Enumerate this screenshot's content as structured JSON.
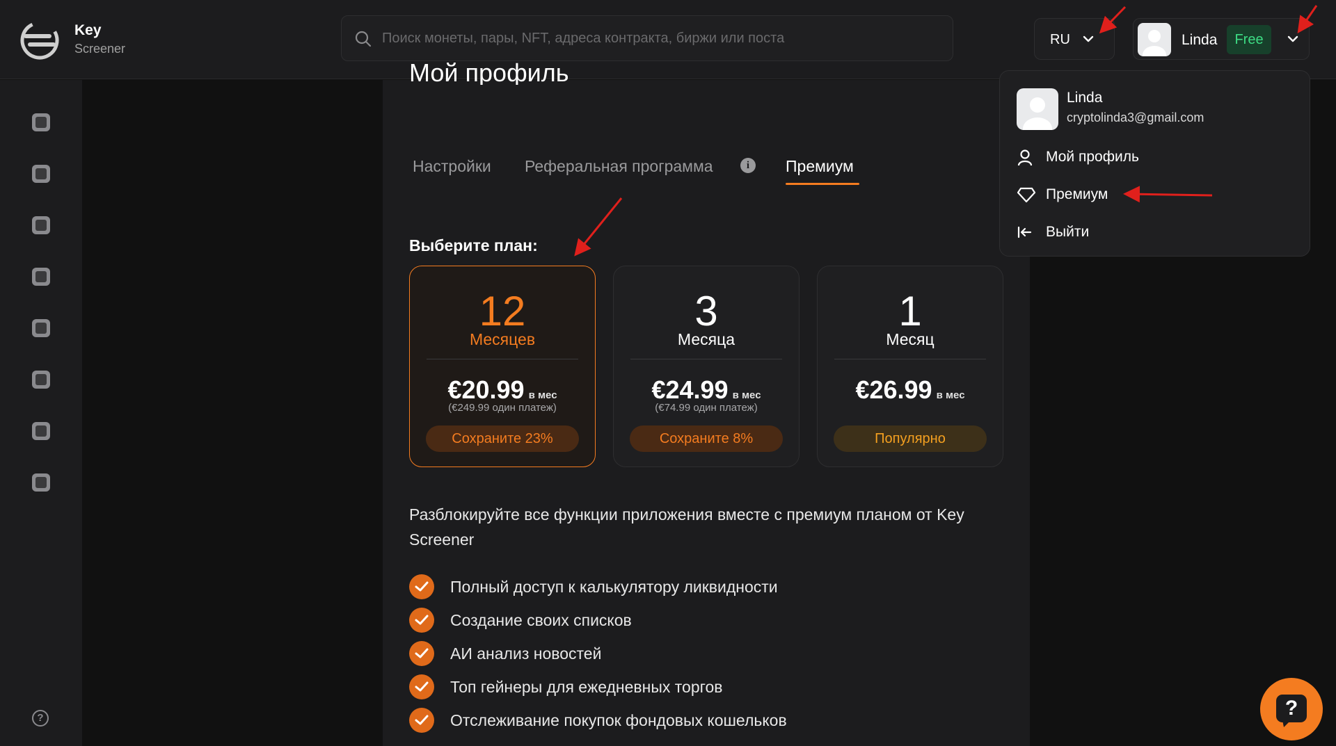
{
  "brand": {
    "name": "Key",
    "sub": "Screener"
  },
  "search": {
    "placeholder": "Поиск монеты, пары, NFT, адреса контракта, биржи или поста"
  },
  "header": {
    "lang": "RU",
    "user_name": "Linda",
    "plan_badge": "Free"
  },
  "profile": {
    "title": "Мой профиль",
    "tabs": [
      {
        "label": "Настройки"
      },
      {
        "label": "Реферальная программа"
      },
      {
        "label": "Премиум"
      }
    ],
    "active_tab": "Премиум"
  },
  "plans": {
    "heading": "Выберите план:",
    "items": [
      {
        "count": "12",
        "unit": "Месяцев",
        "price": "€20.99",
        "per": "в мес",
        "once": "(€249.99 один платеж)",
        "pill": "Сохраните 23%",
        "selected": true
      },
      {
        "count": "3",
        "unit": "Месяца",
        "price": "€24.99",
        "per": "в мес",
        "once": "(€74.99 один платеж)",
        "pill": "Сохраните 8%",
        "selected": false
      },
      {
        "count": "1",
        "unit": "Месяц",
        "price": "€26.99",
        "per": "в мес",
        "once": "",
        "pill": "Популярно",
        "selected": false
      }
    ]
  },
  "description": "Разблокируйте все функции приложения вместе с премиум планом от Key Screener",
  "features": [
    "Полный доступ к калькулятору ликвидности",
    "Создание своих списков",
    "АИ анализ новостей",
    "Топ гейнеры для ежедневных торгов",
    "Отслеживание покупок фондовых кошельков"
  ],
  "dropdown": {
    "name": "Linda",
    "email": "cryptolinda3@gmail.com",
    "items": [
      {
        "label": "Мой профиль",
        "icon": "user-icon"
      },
      {
        "label": "Премиум",
        "icon": "diamond-icon"
      },
      {
        "label": "Выйти",
        "icon": "logout-icon"
      }
    ]
  },
  "help": {
    "symbol": "?"
  },
  "colors": {
    "accent": "#f47c20",
    "free_badge": "#3ddc84",
    "background": "#111111",
    "panel": "#1c1c1e",
    "annotation": "#e0201c"
  }
}
